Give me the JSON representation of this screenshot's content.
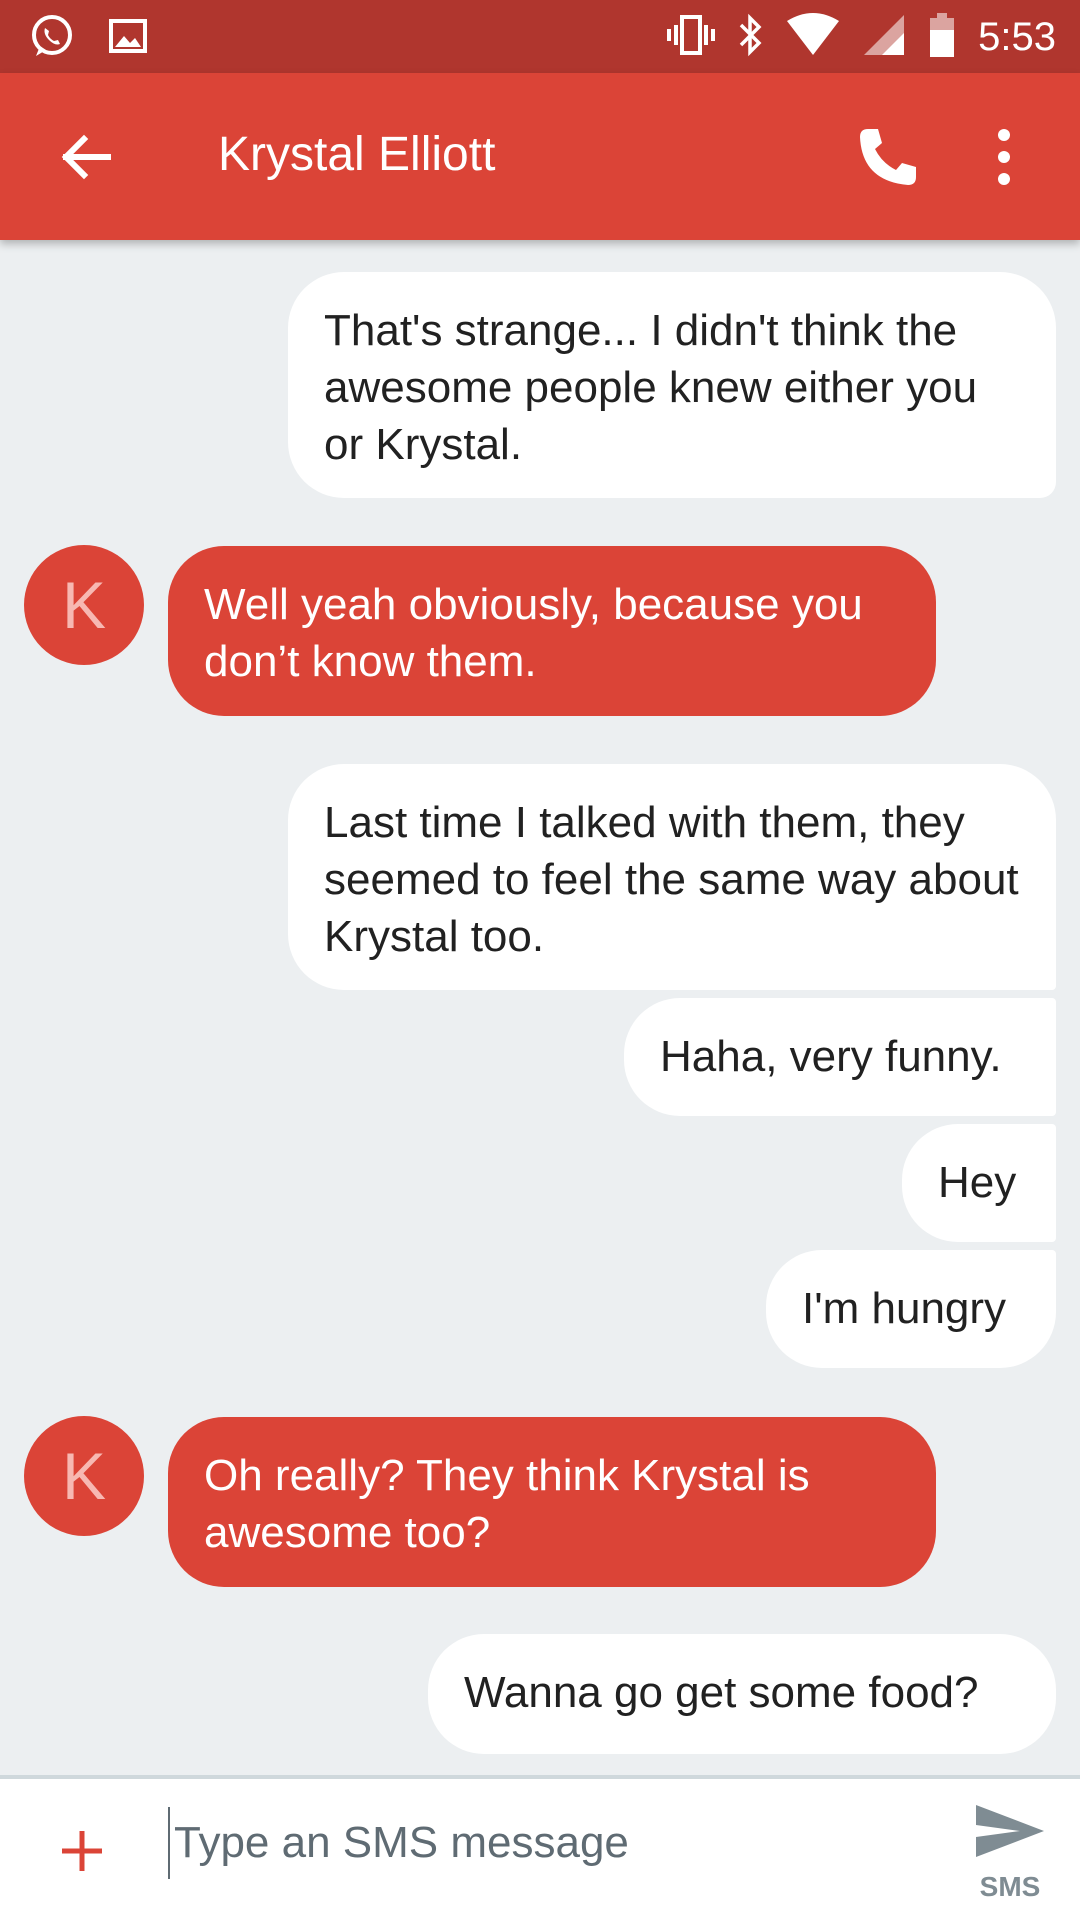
{
  "status_bar": {
    "time": "5:53",
    "icons": [
      "whatsapp-icon",
      "image-icon",
      "vibrate-icon",
      "bluetooth-icon",
      "wifi-icon",
      "cell-signal-icon",
      "battery-icon"
    ]
  },
  "app_bar": {
    "title": "Krystal Elliott",
    "icons": [
      "back-arrow-icon",
      "phone-icon",
      "more-vert-icon"
    ]
  },
  "contact": {
    "initial": "K"
  },
  "messages": [
    {
      "from": "me",
      "text": "That's strange... I didn't think the awesome people knew either you or Krystal."
    },
    {
      "from": "contact",
      "text": "Well yeah obviously, because you don’t know them."
    },
    {
      "from": "me",
      "text": "Last time I talked with them, they seemed to feel the same way about Krystal too."
    },
    {
      "from": "me",
      "text": "Haha, very funny."
    },
    {
      "from": "me",
      "text": "Hey"
    },
    {
      "from": "me",
      "text": "I'm hungry"
    },
    {
      "from": "contact",
      "text": "Oh really? They think Krystal is awesome too?"
    },
    {
      "from": "me",
      "text": "Wanna go get some food?"
    }
  ],
  "composer": {
    "placeholder": "Type an SMS message",
    "send_label": "SMS"
  },
  "colors": {
    "status_bar": "#b0362e",
    "accent": "#db4437",
    "background": "#eceff1",
    "outgoing_bubble": "#ffffff"
  }
}
